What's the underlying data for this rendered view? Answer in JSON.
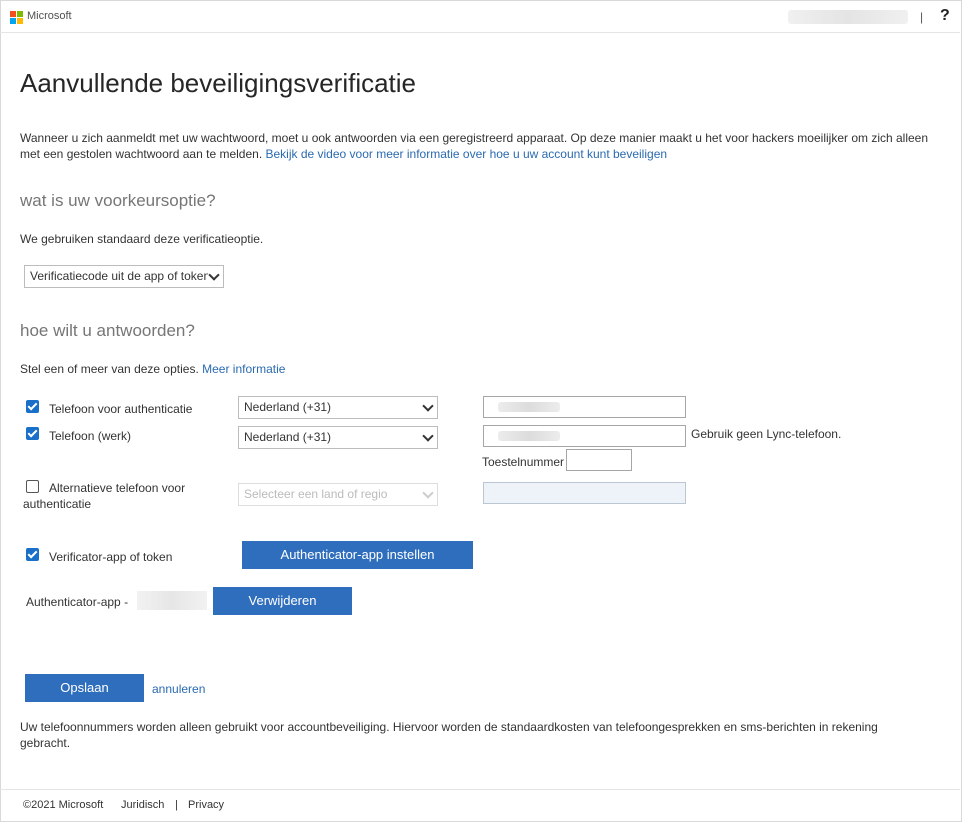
{
  "header": {
    "brand": "Microsoft",
    "separator": "|",
    "help_label": "?"
  },
  "colors": {
    "accent": "#2f6ebd",
    "link": "#2a6ab0",
    "checkbox": "#1a6fc9"
  },
  "page": {
    "title": "Aanvullende beveiligingsverificatie",
    "intro_text": "Wanneer u zich aanmeldt met uw wachtwoord, moet u ook antwoorden via een geregistreerd apparaat. Op deze manier maakt u het voor hackers moeilijker om zich alleen met een gestolen wachtwoord aan te melden. ",
    "intro_link": "Bekijk de video voor meer informatie over hoe u uw account kunt beveiligen"
  },
  "preference": {
    "heading": "wat is uw voorkeursoptie?",
    "description": "We gebruiken standaard deze verificatieoptie.",
    "selected": "Verificatiecode uit de app of token"
  },
  "respond": {
    "heading": "hoe wilt u antwoorden?",
    "description": "Stel een of meer van deze opties. ",
    "more_info": "Meer informatie",
    "options": [
      {
        "label": "Telefoon voor authenticatie",
        "checked": true,
        "country": "Nederland (+31)"
      },
      {
        "label": "Telefoon (werk)",
        "checked": true,
        "country": "Nederland (+31)",
        "note": "Gebruik geen Lync-telefoon.",
        "extension_label": "Toestelnummer"
      },
      {
        "label_line1": "Alternatieve telefoon voor",
        "label_line2": "authenticatie",
        "checked": false,
        "country_placeholder": "Selecteer een land of regio"
      },
      {
        "label": "Verificator-app of token",
        "checked": true,
        "button": "Authenticator-app instellen"
      }
    ],
    "authenticator_label": "Authenticator-app -",
    "remove_button": "Verwijderen"
  },
  "actions": {
    "save": "Opslaan",
    "cancel": "annuleren"
  },
  "disclaimer": "Uw telefoonnummers worden alleen gebruikt voor accountbeveiliging. Hiervoor worden de standaardkosten van telefoongesprekken en sms-berichten in rekening gebracht.",
  "footer": {
    "copyright": "©2021 Microsoft",
    "legal": "Juridisch",
    "separator": "|",
    "privacy": "Privacy"
  }
}
